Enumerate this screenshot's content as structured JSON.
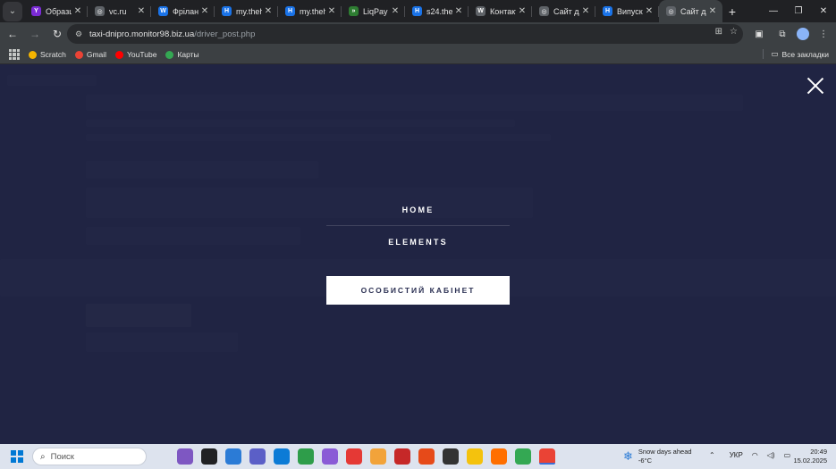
{
  "browser": {
    "tabs": [
      {
        "title": "Образц",
        "favicon_color": "#7b2bd6",
        "favicon_glyph": "Y"
      },
      {
        "title": "vc.ru",
        "favicon_color": "#5f6368",
        "favicon_glyph": "◎"
      },
      {
        "title": "Фріланс",
        "favicon_color": "#1a73e8",
        "favicon_glyph": "W"
      },
      {
        "title": "my.theh",
        "favicon_color": "#1a73e8",
        "favicon_glyph": "H"
      },
      {
        "title": "my.theh",
        "favicon_color": "#1a73e8",
        "favicon_glyph": "H"
      },
      {
        "title": "LiqPay T",
        "favicon_color": "#2e7d32",
        "favicon_glyph": "»"
      },
      {
        "title": "s24.theh",
        "favicon_color": "#1a73e8",
        "favicon_glyph": "H"
      },
      {
        "title": "Контакт",
        "favicon_color": "#5f6368",
        "favicon_glyph": "W"
      },
      {
        "title": "Сайт дл",
        "favicon_color": "#5f6368",
        "favicon_glyph": "◎"
      },
      {
        "title": "Випуск",
        "favicon_color": "#1a73e8",
        "favicon_glyph": "H"
      },
      {
        "title": "Сайт дл",
        "favicon_color": "#5f6368",
        "favicon_glyph": "◎",
        "active": true
      }
    ],
    "tab_close_glyph": "✕",
    "new_tab_glyph": "+",
    "window_controls": {
      "minimize": "—",
      "maximize": "❐",
      "close": "✕"
    },
    "url": {
      "host": "taxi-dnipro.monitor98.biz.ua",
      "path": "/driver_post.php"
    },
    "bookmarks": [
      {
        "label": "Scratch",
        "color": "#f4b400"
      },
      {
        "label": "Gmail",
        "color": "#ea4335"
      },
      {
        "label": "YouTube",
        "color": "#ff0000"
      },
      {
        "label": "Карты",
        "color": "#34a853"
      }
    ],
    "all_bookmarks_label": "Все закладки"
  },
  "overlay_menu": {
    "items": [
      {
        "label": "HOME"
      },
      {
        "label": "ELEMENTS"
      }
    ],
    "cabinet_button": "ОСОБИСТИЙ КАБІНЕТ"
  },
  "taskbar": {
    "search_placeholder": "Поиск",
    "apps": [
      {
        "icon": "widgets-icon",
        "color": "#7e57c2"
      },
      {
        "icon": "task-view-icon",
        "color": "#202124"
      },
      {
        "icon": "copilot-icon",
        "color": "#2b7bd6"
      },
      {
        "icon": "teams-icon",
        "color": "#5b5fc7"
      },
      {
        "icon": "edge-icon",
        "color": "#0c7bd6"
      },
      {
        "icon": "app-green-icon",
        "color": "#2e9d4a"
      },
      {
        "icon": "visual-studio-icon",
        "color": "#8a5bd6"
      },
      {
        "icon": "app-color-icon",
        "color": "#e53935"
      },
      {
        "icon": "app-wave-icon",
        "color": "#f2a33a"
      },
      {
        "icon": "app-red-icon",
        "color": "#c62828"
      },
      {
        "icon": "app-diamond-icon",
        "color": "#e64a19"
      },
      {
        "icon": "terminal-icon",
        "color": "#333333"
      },
      {
        "icon": "file-explorer-icon",
        "color": "#f4c20d"
      },
      {
        "icon": "sublime-icon",
        "color": "#ff6f00"
      },
      {
        "icon": "app-multicolor-icon",
        "color": "#34a853"
      },
      {
        "icon": "chrome-icon",
        "color": "#ea4335",
        "active": true
      }
    ],
    "weather": {
      "line1": "Snow days ahead",
      "line2": "-6°C"
    },
    "language": "УКР",
    "clock": {
      "time": "20:49",
      "date": "15.02.2025"
    }
  }
}
